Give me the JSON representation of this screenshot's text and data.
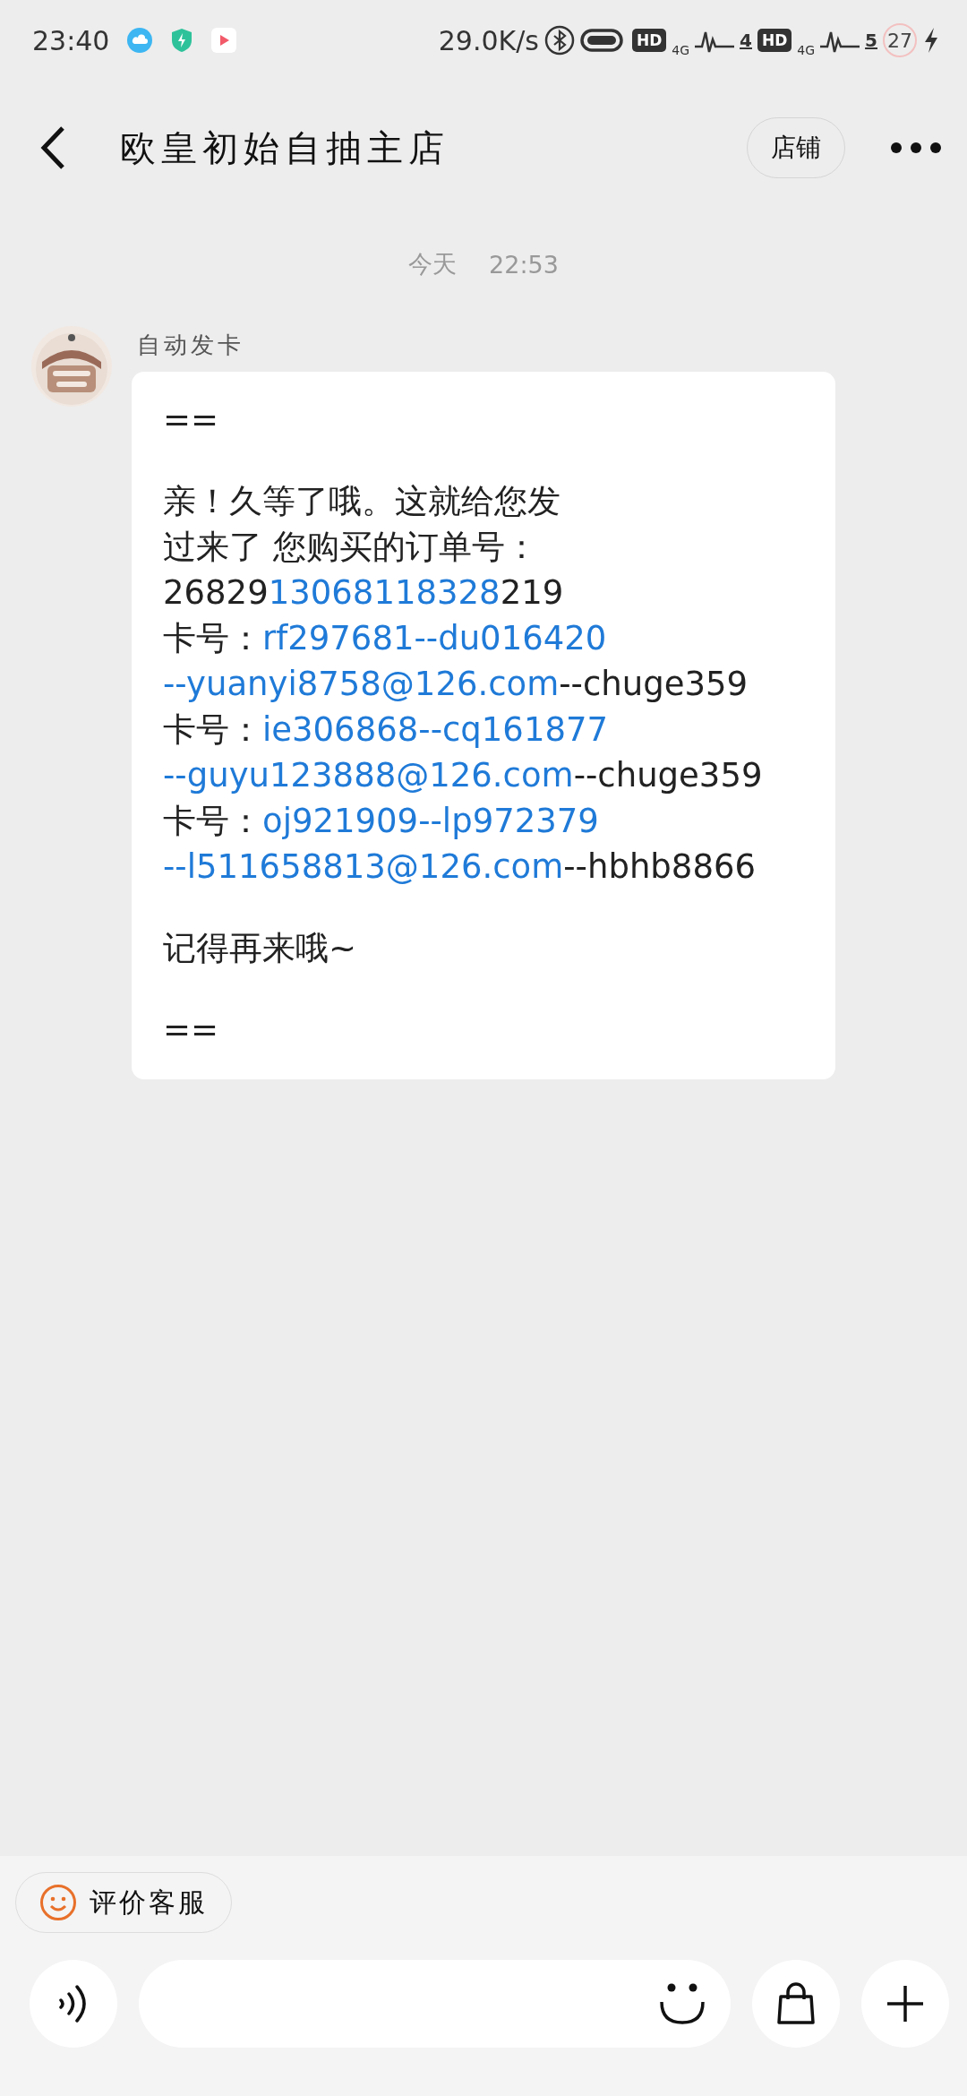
{
  "status_bar": {
    "time": "23:40",
    "speed": "29.0K/s",
    "sim1": {
      "hd": "HD",
      "network": "4G",
      "signal": "4"
    },
    "sim2": {
      "hd": "HD",
      "network": "4G",
      "signal": "5"
    },
    "battery": "27"
  },
  "header": {
    "title": "欧皇初始自抽主店",
    "shop_button": "店铺"
  },
  "timestamp": {
    "day": "今天",
    "time": "22:53"
  },
  "message": {
    "sender": "自动发卡",
    "lines": [
      {
        "kind": "text",
        "segments": [
          {
            "text": "==",
            "link": false
          }
        ]
      },
      {
        "kind": "spacer"
      },
      {
        "kind": "text",
        "segments": [
          {
            "text": "亲！久等了哦。这就给您发",
            "link": false
          }
        ]
      },
      {
        "kind": "text",
        "segments": [
          {
            "text": "过来了 您购买的订单号：",
            "link": false
          }
        ]
      },
      {
        "kind": "text",
        "segments": [
          {
            "text": "26829",
            "link": false
          },
          {
            "text": "13068118328",
            "link": true
          },
          {
            "text": "219",
            "link": false
          }
        ]
      },
      {
        "kind": "text",
        "segments": [
          {
            "text": "卡号：",
            "link": false
          },
          {
            "text": "rf297681--du016420",
            "link": true
          }
        ]
      },
      {
        "kind": "text",
        "segments": [
          {
            "text": "--yuanyi8758@126.com",
            "link": true
          },
          {
            "text": "--chuge359",
            "link": false
          }
        ]
      },
      {
        "kind": "text",
        "segments": [
          {
            "text": "卡号：",
            "link": false
          },
          {
            "text": "ie306868--cq161877",
            "link": true
          }
        ]
      },
      {
        "kind": "text",
        "segments": [
          {
            "text": "--guyu123888@126.com",
            "link": true
          },
          {
            "text": "--chuge359",
            "link": false
          }
        ]
      },
      {
        "kind": "text",
        "segments": [
          {
            "text": "卡号：",
            "link": false
          },
          {
            "text": "oj921909--lp972379",
            "link": true
          }
        ]
      },
      {
        "kind": "text",
        "segments": [
          {
            "text": "--l511658813@126.com",
            "link": true
          },
          {
            "text": "--hbhb8866",
            "link": false
          }
        ]
      },
      {
        "kind": "spacer"
      },
      {
        "kind": "text",
        "segments": [
          {
            "text": "记得再来哦~",
            "link": false
          }
        ]
      },
      {
        "kind": "spacer"
      },
      {
        "kind": "text",
        "segments": [
          {
            "text": "==",
            "link": false
          }
        ]
      }
    ]
  },
  "rate_chip": {
    "label": "评价客服"
  }
}
